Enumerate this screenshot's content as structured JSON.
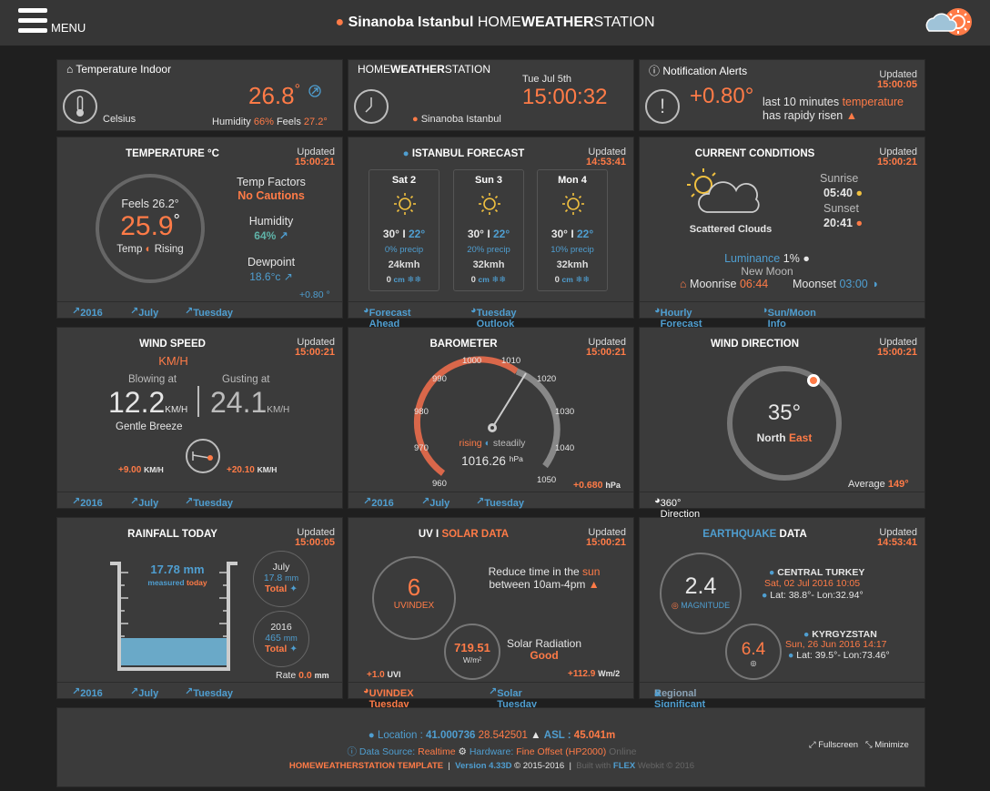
{
  "topbar": {
    "menu_label": "MENU",
    "title_location": "Sinanoba Istanbul",
    "title_home": "HOME",
    "title_weather": "WEATHER",
    "title_station": "STATION"
  },
  "indoor": {
    "header": "Temperature Indoor",
    "temp": "26.8",
    "deg": "°",
    "unit_label": "Celsius",
    "humidity_label": "Humidity",
    "humidity": "66%",
    "feels_label": "Feels",
    "feels": "27.2°"
  },
  "station": {
    "home": "HOME",
    "weather": "WEATHER",
    "station": "STATION",
    "date": "Tue Jul 5th",
    "time": "15:00:32",
    "location": "Sinanoba Istanbul"
  },
  "alerts": {
    "header": "Notification Alerts",
    "updated": "Updated",
    "updated_time": "15:00:05",
    "value": "+0.80°",
    "line1_pre": "last 10 minutes",
    "line1_word": "temperature",
    "line2": "has rapidy risen"
  },
  "temperature": {
    "title": "TEMPERATURE °C",
    "updated": "Updated",
    "updated_time": "15:00:21",
    "feels": "Feels 26.2°",
    "value": "25.9",
    "deg": "°",
    "trend_label": "Temp",
    "trend": "Rising",
    "factors_label": "Temp Factors",
    "factors": "No Cautions",
    "humidity_label": "Humidity",
    "humidity": "64%",
    "dewpoint_label": "Dewpoint",
    "dewpoint": "18.6°c",
    "change": "+0.80 °",
    "foot": [
      "2016",
      "July",
      "Tuesday"
    ]
  },
  "forecast": {
    "title": "ISTANBUL FORECAST",
    "updated": "Updated",
    "updated_time": "14:53:41",
    "days": [
      {
        "day": "Sat 2",
        "hi": "30°",
        "lo": "22°",
        "precip": "0% precip",
        "wind": "24kmh",
        "snow": "0",
        "snow_unit": "cm"
      },
      {
        "day": "Sun 3",
        "hi": "30°",
        "lo": "22°",
        "precip": "20% precip",
        "wind": "32kmh",
        "snow": "0",
        "snow_unit": "cm"
      },
      {
        "day": "Mon 4",
        "hi": "30°",
        "lo": "22°",
        "precip": "10% precip",
        "wind": "32kmh",
        "snow": "0",
        "snow_unit": "cm"
      }
    ],
    "foot": [
      "Forecast Ahead",
      "Tuesday Outlook"
    ]
  },
  "conditions": {
    "title": "CURRENT CONDITIONS",
    "updated": "Updated",
    "updated_time": "15:00:21",
    "description": "Scattered Clouds",
    "sunrise_label": "Sunrise",
    "sunrise": "05:40",
    "sunset_label": "Sunset",
    "sunset": "20:41",
    "luminance_label": "Luminance",
    "luminance": "1%",
    "moon_phase": "New Moon",
    "moonrise_label": "Moonrise",
    "moonrise": "06:44",
    "moonset_label": "Moonset",
    "moonset": "03:00",
    "foot": [
      "Hourly Forecast",
      "Sun/Moon Info"
    ]
  },
  "wind": {
    "title": "WIND SPEED",
    "updated": "Updated",
    "updated_time": "15:00:21",
    "unit": "KM/H",
    "blowing_label": "Blowing at",
    "blowing": "12.2",
    "gusting_label": "Gusting at",
    "gusting": "24.1",
    "small_unit": "KM/H",
    "description": "Gentle Breeze",
    "change1": "+9.00",
    "change2": "+20.10",
    "foot": [
      "2016",
      "July",
      "Tuesday"
    ]
  },
  "barometer": {
    "title": "BAROMETER",
    "updated": "Updated",
    "updated_time": "15:00:21",
    "ticks": [
      "960",
      "970",
      "980",
      "990",
      "1000",
      "1010",
      "1020",
      "1030",
      "1040",
      "1050"
    ],
    "trend": "rising",
    "trend2": "steadily",
    "value": "1016.26",
    "unit": "hPa",
    "change": "+0.680",
    "change_unit": "hPa",
    "foot": [
      "2016",
      "July",
      "Tuesday"
    ]
  },
  "winddir": {
    "title": "WIND DIRECTION",
    "updated": "Updated",
    "updated_time": "15:00:21",
    "degrees": "35°",
    "dir1": "North",
    "dir2": "East",
    "average_label": "Average",
    "average": "149°",
    "foot": [
      "360° Direction"
    ]
  },
  "rainfall": {
    "title": "RAINFALL TODAY",
    "updated": "Updated",
    "updated_time": "15:00:05",
    "amount": "17.78 mm",
    "measured": "measured",
    "today": "today",
    "july_label": "July",
    "july": "17.8",
    "year_label": "2016",
    "year": "465",
    "mm": "mm",
    "total": "Total",
    "rate_label": "Rate",
    "rate": "0.0",
    "rate_unit": "mm",
    "foot": [
      "2016",
      "July",
      "Tuesday"
    ]
  },
  "uv": {
    "title_uv": "UV",
    "title_solar": "SOLAR DATA",
    "updated": "Updated",
    "updated_time": "15:00:21",
    "index": "6",
    "index_label": "UVINDEX",
    "advice1_pre": "Reduce time in the",
    "advice1_word": "sun",
    "advice2": "between 10am-4pm",
    "solar": "719.51",
    "solar_unit": "W/m²",
    "solar_label": "Solar Radiation",
    "solar_rating": "Good",
    "uvi_change": "+1.0",
    "uvi_unit": "UVI",
    "solar_change": "+112.9",
    "solar_change_unit": "Wm/2",
    "foot": [
      "UVINDEX Tuesday",
      "Solar Tuesday"
    ]
  },
  "quake": {
    "title_a": "EARTHQUAKE",
    "title_b": "DATA",
    "updated": "Updated",
    "updated_time": "14:53:41",
    "mag1": "2.4",
    "mag_label": "MAGNITUDE",
    "loc1": "CENTRAL TURKEY",
    "date1": "Sat, 02 Jul 2016 10:05",
    "coords1": "Lat: 38.8°- Lon:32.94°",
    "mag2": "6.4",
    "loc2": "KYRGYZSTAN",
    "date2": "Sun, 26 Jun 2016 14:17",
    "coords2": "Lat: 39.5°- Lon:73.46°",
    "foot_a": "Regional",
    "foot_b": "& Significant Earthquakes"
  },
  "footer": {
    "location_label": "Location :",
    "lat": "41.000736",
    "lon": "28.542501",
    "asl_label": "ASL :",
    "asl": "45.041m",
    "source_label": "Data Source:",
    "source": "Realtime",
    "hardware_label": "Hardware:",
    "hardware": "Fine Offset (HP2000)",
    "online": "Online",
    "template": "HOMEWEATHERSTATION TEMPLATE",
    "version": "Version 4.33D",
    "copyright": "© 2015-2016",
    "built_with": "Built with",
    "flex": "FLEX",
    "webkit": "Webkit © 2016",
    "fullscreen": "Fullscreen",
    "minimize": "Minimize"
  },
  "colors": {
    "accent_orange": "#ff7b47",
    "accent_blue": "#4f9ed0",
    "card_bg": "#3b3b3b",
    "page_bg": "#1f1f1f"
  }
}
